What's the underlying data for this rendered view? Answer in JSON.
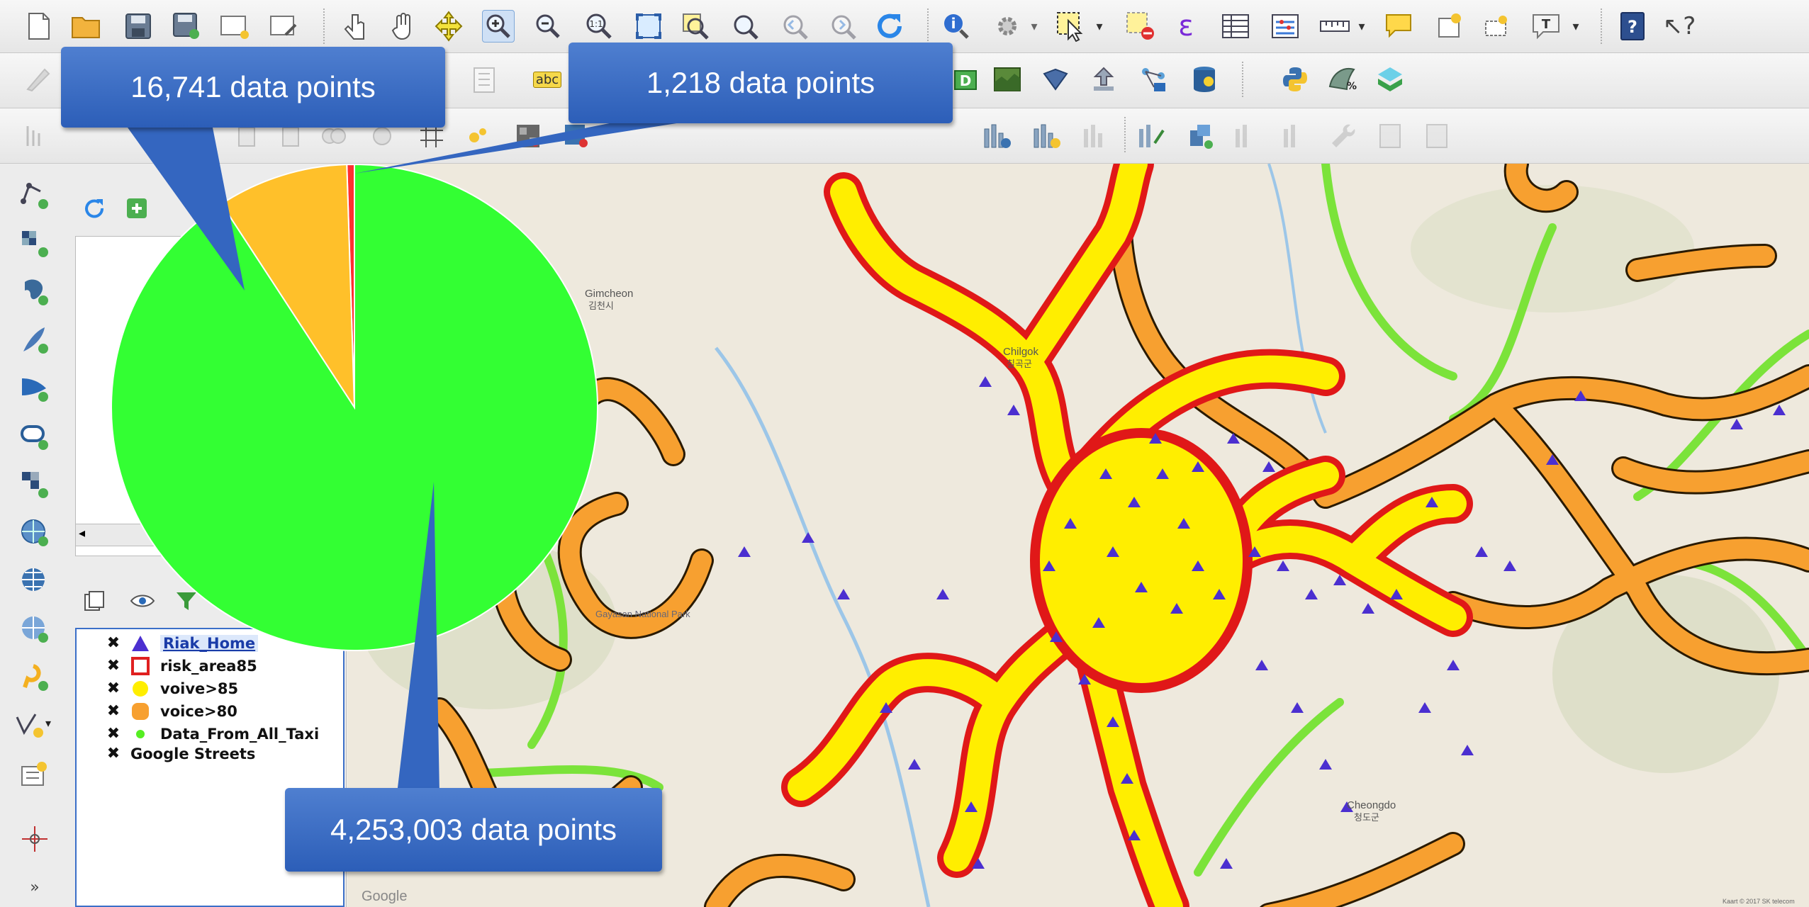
{
  "callouts": {
    "orange_count": "16,741 data points",
    "red_count": "1,218 data points",
    "green_count": "4,253,003 data points"
  },
  "chart_data": {
    "type": "pie",
    "categories": [
      "Data_From_All_Taxi",
      "voice>80",
      "risk_area85"
    ],
    "values": [
      4253003,
      16741,
      1218
    ],
    "display_fractions": [
      0.908,
      0.087,
      0.005
    ],
    "colors": [
      "#33ff33",
      "#ffc02a",
      "#ff3030"
    ],
    "labels": [
      "4,253,003 data points",
      "16,741 data points",
      "1,218 data points"
    ]
  },
  "legend": {
    "layers": [
      {
        "name": "Riak_Home",
        "checked": "✖",
        "symbol": "blue-triangle",
        "color": "#4b2fd0"
      },
      {
        "name": "risk_area85",
        "checked": "✖",
        "symbol": "red-square",
        "color": "#e02020"
      },
      {
        "name": "voive>85",
        "checked": "✖",
        "symbol": "yellow-circle",
        "color": "#ffee00"
      },
      {
        "name": "voice>80",
        "checked": "✖",
        "symbol": "orange-rounded-square",
        "color": "#f7a030"
      },
      {
        "name": "Data_From_All_Taxi",
        "checked": "✖",
        "symbol": "green-dot",
        "color": "#55ee22"
      },
      {
        "name": "Google Streets",
        "checked": "✖",
        "symbol": "none",
        "color": ""
      }
    ]
  },
  "map": {
    "places": [
      "Gimcheon",
      "김천시",
      "Chilgok",
      "칠곡군",
      "Gayasan National Park",
      "Cheongdo",
      "청도군"
    ],
    "attribution": "Google",
    "copyright": "Kaart © 2017 SK telecom"
  },
  "toolbar": {
    "icons": [
      "new-project-icon",
      "open-project-icon",
      "save-project-icon",
      "save-as-icon",
      "new-print-layout-icon",
      "layout-manager-icon",
      "touch-zoom-pan-icon",
      "pan-hand-icon",
      "pan-to-selection-icon",
      "zoom-in-icon",
      "zoom-out-icon",
      "zoom-native-icon",
      "zoom-full-icon",
      "zoom-to-selection-icon",
      "zoom-to-layer-icon",
      "zoom-last-icon",
      "zoom-next-icon",
      "refresh-icon",
      "identify-icon",
      "feature-action-icon",
      "select-features-icon",
      "deselect-icon",
      "field-calculator-icon",
      "attribute-table-icon",
      "statistics-icon",
      "measure-icon",
      "map-tips-icon",
      "new-bookmark-icon",
      "show-bookmarks-icon",
      "text-annotation-icon",
      "help-icon",
      "whats-this-icon"
    ],
    "label_abc": "abc",
    "text_tool": "T",
    "epsilon": "ε",
    "whats_this": "↖?"
  },
  "colors": {
    "accent_blue": "#3b6fc8",
    "callout_blue": "#2f62bd"
  }
}
